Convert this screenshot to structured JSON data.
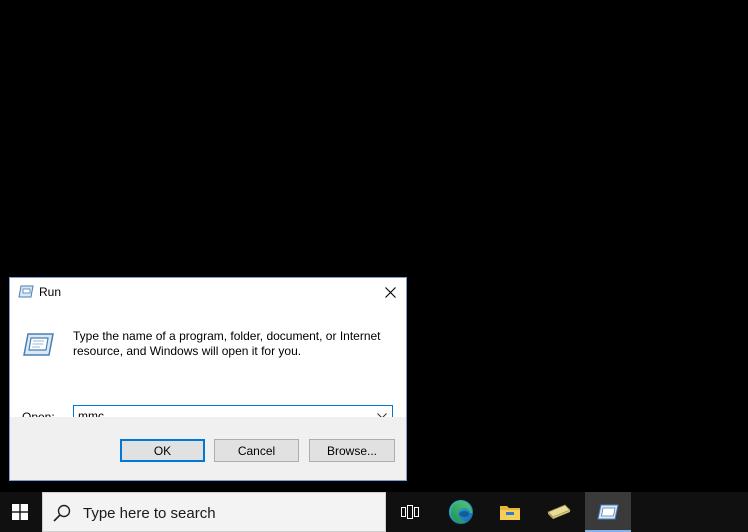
{
  "run_dialog": {
    "title": "Run",
    "description": "Type the name of a program, folder, document, or Internet resource, and Windows will open it for you.",
    "open_label": "Open:",
    "open_value": "mmc",
    "buttons": {
      "ok": "OK",
      "cancel": "Cancel",
      "browse": "Browse..."
    },
    "icons": {
      "title": "run-icon",
      "body": "run-icon",
      "close": "close-icon",
      "dropdown": "chevron-down-icon"
    }
  },
  "taskbar": {
    "search_placeholder": "Type here to search",
    "items": [
      {
        "name": "task-view",
        "icon": "task-view-icon"
      },
      {
        "name": "edge",
        "icon": "edge-icon"
      },
      {
        "name": "file-explorer",
        "icon": "folder-icon"
      },
      {
        "name": "app",
        "icon": "app-icon"
      },
      {
        "name": "run",
        "icon": "run-icon",
        "active": true
      }
    ]
  },
  "colors": {
    "desktop_bg": "#000000",
    "taskbar_bg": "#101010",
    "accent": "#0078d7",
    "dialog_bg": "#f0f0f0"
  }
}
